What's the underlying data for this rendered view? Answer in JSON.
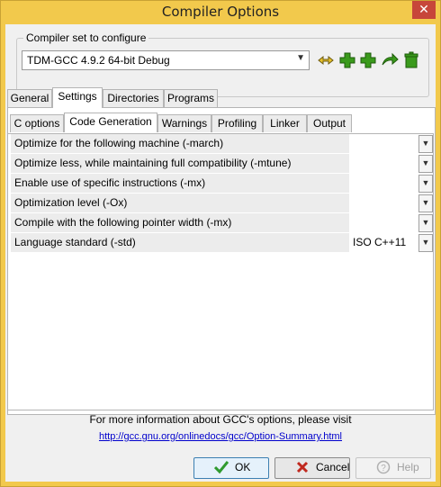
{
  "window": {
    "title": "Compiler Options",
    "close_glyph": "✕"
  },
  "compiler_set": {
    "legend": "Compiler set to configure",
    "selected": "TDM-GCC 4.9.2 64-bit Debug",
    "arrow_glyph": "▼",
    "tools": [
      "rename-icon",
      "add-icon",
      "add-copy-icon",
      "reload-icon",
      "delete-icon"
    ]
  },
  "tabs": [
    "General",
    "Settings",
    "Directories",
    "Programs"
  ],
  "active_tab": "Settings",
  "subtabs": [
    "C options",
    "Code Generation",
    "Warnings",
    "Profiling",
    "Linker",
    "Output"
  ],
  "active_subtab": "Code Generation",
  "options": [
    {
      "label": "Optimize for the following machine (-march)",
      "value": ""
    },
    {
      "label": "Optimize less, while maintaining full compatibility (-mtune)",
      "value": ""
    },
    {
      "label": "Enable use of specific instructions (-mx)",
      "value": ""
    },
    {
      "label": "Optimization level (-Ox)",
      "value": ""
    },
    {
      "label": "Compile with the following pointer width (-mx)",
      "value": ""
    },
    {
      "label": "Language standard (-std)",
      "value": "ISO C++11"
    }
  ],
  "drop_glyph": "▼",
  "info": {
    "text": "For more information about GCC's options, please visit",
    "link": "http://gcc.gnu.org/onlinedocs/gcc/Option-Summary.html"
  },
  "buttons": {
    "ok": "OK",
    "cancel": "Cancel",
    "help": "Help"
  },
  "colors": {
    "title_bar": "#f2c94c",
    "close": "#c7463a",
    "link": "#0000cc",
    "tool_green": "#3a9a1c",
    "ok_check": "#2f9a2f",
    "cancel_x": "#c0281e"
  }
}
